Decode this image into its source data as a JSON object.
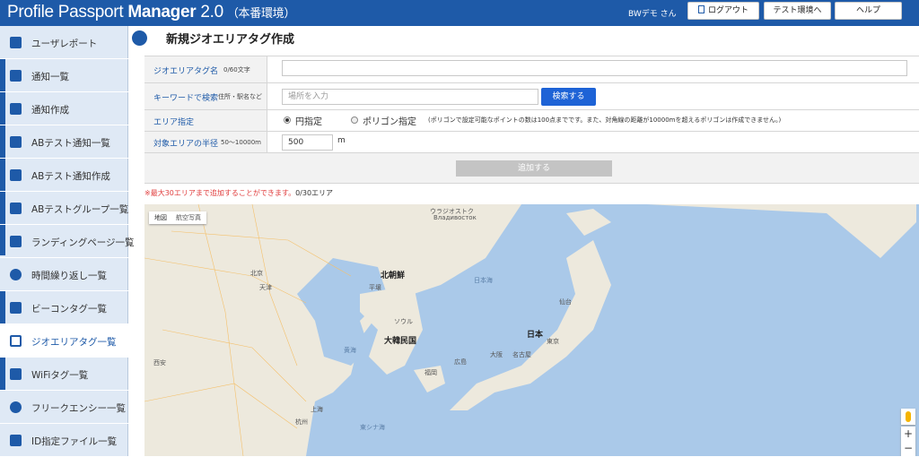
{
  "header": {
    "brand": "Profile Passport",
    "brand_bold": "Manager",
    "brand_version": "2.0",
    "brand_env": "（本番環境）",
    "user": "BWデモ さん",
    "logout_label": "ログアウト",
    "test_env_label": "テスト環境へ",
    "help_label": "ヘルプ"
  },
  "sidebar": {
    "items": [
      {
        "label": "ユーザレポート",
        "icon": "user-report-icon"
      },
      {
        "label": "通知一覧",
        "icon": "list-icon"
      },
      {
        "label": "通知作成",
        "icon": "edit-icon"
      },
      {
        "label": "ABテスト通知一覧",
        "icon": "list-icon"
      },
      {
        "label": "ABテスト通知作成",
        "icon": "edit-icon"
      },
      {
        "label": "ABテストグループ一覧",
        "icon": "group-icon"
      },
      {
        "label": "ランディングページ一覧",
        "icon": "landing-icon"
      },
      {
        "label": "時間繰り返し一覧",
        "icon": "clock-icon"
      },
      {
        "label": "ビーコンタグ一覧",
        "icon": "bluetooth-icon"
      },
      {
        "label": "ジオエリアタグ一覧",
        "icon": "geo-area-icon"
      },
      {
        "label": "WiFiタグ一覧",
        "icon": "wifi-icon"
      },
      {
        "label": "フリークエンシー一覧",
        "icon": "frequency-icon"
      },
      {
        "label": "ID指定ファイル一覧",
        "icon": "id-file-icon"
      }
    ],
    "active_index": 9
  },
  "page": {
    "title": "新規ジオエリアタグ作成",
    "name_label": "ジオエリアタグ名",
    "name_counter": "0/60文字",
    "name_value": "",
    "keyword_label": "キーワードで検索",
    "keyword_hint": "住所・駅名など",
    "keyword_placeholder": "場所を入力",
    "search_button": "検索する",
    "area_label": "エリア指定",
    "radio_circle": "円指定",
    "radio_polygon": "ポリゴン指定",
    "polygon_note": "(ポリゴンで設定可能なポイントの数は100点までです。また、対角線の距離が10000mを超えるポリゴンは作成できません。)",
    "radius_label": "対象エリアの半径",
    "radius_range": "50〜10000m",
    "radius_value": "500",
    "radius_unit": "m",
    "add_button": "追加する",
    "note_mark": "※",
    "note_text": "最大30エリアまで追加することができます。",
    "note_count": "0/30エリア"
  },
  "map": {
    "tab_map": "地図",
    "tab_aerial": "航空写真",
    "zoom_in": "+",
    "zoom_out": "−",
    "labels": [
      {
        "text": "ウラジオストク",
        "kind": "small"
      },
      {
        "text": "Владивосток",
        "kind": "small"
      },
      {
        "text": "北朝鮮",
        "kind": "big"
      },
      {
        "text": "大韓民国",
        "kind": "big"
      },
      {
        "text": "日本",
        "kind": "big"
      },
      {
        "text": "日本海",
        "kind": "sea"
      },
      {
        "text": "北京",
        "kind": "small"
      },
      {
        "text": "天津",
        "kind": "small"
      },
      {
        "text": "平壌",
        "kind": "small"
      },
      {
        "text": "ソウル",
        "kind": "small"
      },
      {
        "text": "仙台",
        "kind": "small"
      },
      {
        "text": "東京",
        "kind": "small"
      },
      {
        "text": "名古屋",
        "kind": "small"
      },
      {
        "text": "大阪",
        "kind": "small"
      },
      {
        "text": "広島",
        "kind": "small"
      },
      {
        "text": "福岡",
        "kind": "small"
      },
      {
        "text": "上海",
        "kind": "small"
      },
      {
        "text": "杭州",
        "kind": "small"
      },
      {
        "text": "西安",
        "kind": "small"
      },
      {
        "text": "黄海",
        "kind": "sea"
      },
      {
        "text": "東シナ海",
        "kind": "sea"
      }
    ],
    "colors": {
      "sea": "#aac9e9",
      "land": "#ede9dd",
      "road": "#f4c06b"
    }
  }
}
